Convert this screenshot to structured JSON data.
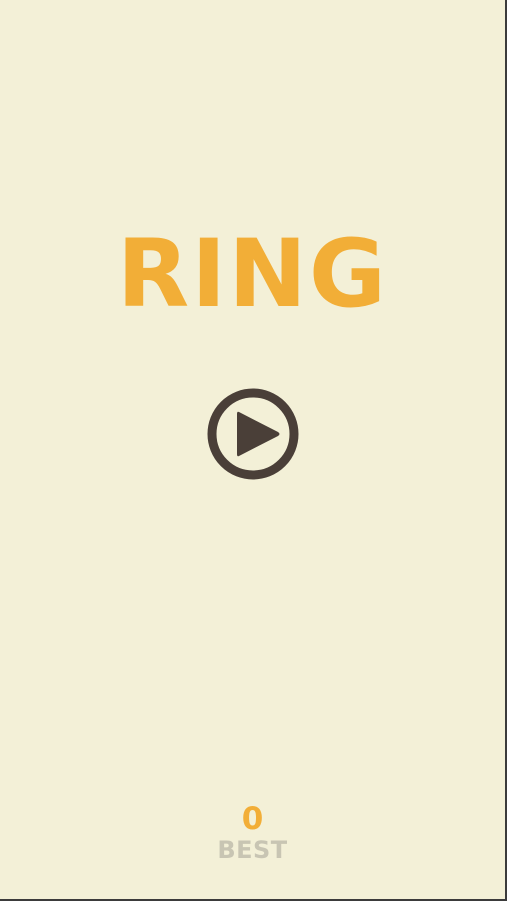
{
  "game": {
    "title": "RING",
    "best_score": "0",
    "best_label": "BEST"
  },
  "icons": {
    "play": "play-circle-icon"
  },
  "colors": {
    "background": "#f3f0d7",
    "title": "#f2ae37",
    "play_icon": "#4a3f38",
    "score": "#f2ae37",
    "best_label": "#c8c5b3",
    "frame_border": "#3b3b3b"
  }
}
